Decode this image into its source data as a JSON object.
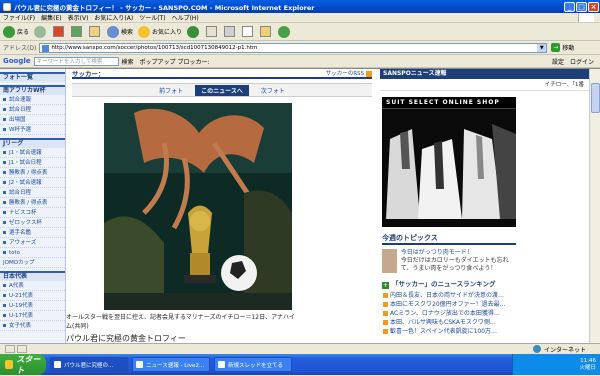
{
  "window": {
    "title": "パウル君に究極の黄金トロフィー！ - サッカー - SANSPO.COM - Microsoft Internet Explorer"
  },
  "menu": [
    "ファイル(F)",
    "編集(E)",
    "表示(V)",
    "お気に入り(A)",
    "ツール(T)",
    "ヘルプ(H)"
  ],
  "toolbar": {
    "back": "戻る",
    "search": "検索",
    "favorites": "お気に入り"
  },
  "address": {
    "label": "アドレス(D)",
    "url": "http://www.sanspo.com/soccer/photos/100713/scd1007130849012-p1.htm",
    "go": "移動"
  },
  "googlebar": {
    "logo": "Google",
    "placeholder": "キーワードを入力して検索",
    "search": "検索",
    "popup": "ポップアップ ブロッカー:",
    "settings": "設定",
    "login": "ログイン"
  },
  "leftnav": {
    "top": "フォト一覧",
    "sec1": {
      "title": "南アフリカW杯",
      "items": [
        "試合速報",
        "試合日程",
        "出場国",
        "W杯予選"
      ]
    },
    "sec2": {
      "title": "Jリーグ",
      "items": [
        "J1・試合速報",
        "J1・試合日程",
        "勝敗表 / 得点表",
        "J2・試合速報",
        "試合日程",
        "勝敗表 / 得点表",
        "ナビスコ杯",
        "ゼロックス杯",
        "選手名鑑",
        "アウォーズ",
        "toto"
      ],
      "extra": "JOMOカップ"
    },
    "sec3": {
      "title": "日本代表",
      "items": [
        "A代表",
        "U-21代表",
        "U-19代表",
        "U-17代表",
        "女子代表"
      ]
    }
  },
  "main": {
    "heading": "サッカー：",
    "rss": "サッカーのRSS",
    "photonav": {
      "prev": "前フォト",
      "current": "このニュースへ",
      "next": "次フォト"
    },
    "caption": "オールスター戦を翌日に控え、記者会見するマリナーズのイチロー＝12日、アナハイム(共同)",
    "next_text": "パウル君に究極の黄金トロフィー"
  },
  "right": {
    "header": "SANSPOニュース速報",
    "subline": "イチロー、「1番",
    "ad_title": "SUIT SELECT ONLINE SHOP",
    "topics_title": "今週のトピックス",
    "topic": {
      "line1": "今日はがっつり肉モード！",
      "line2": "今日だけはカロリーもダイエットも忘れて、うまい肉をがっつり食べよう！"
    },
    "ranking_title": "「サッカー」のニュースランキング",
    "ranking": [
      "内田＆長友、日本の両サイドが決意の渡…",
      "本田にモスクワ20億円オファー！過去最…",
      "ACミラン、ロナウジ放出での本田獲得…",
      "本田、バルサ興味もCSKAモスクワ側…",
      "歓喜一色！スペイン代表凱旋に100万…"
    ]
  },
  "statusbar": {
    "zone": "インターネット"
  },
  "taskbar": {
    "start": "スタート",
    "tasks": [
      "パウル君に究極の…",
      "ニュース速報 - Live2…",
      "新規スレッドを立てる"
    ],
    "time": "11:46",
    "day": "火曜日"
  },
  "colors": {
    "navy": "#1c3f7a",
    "link": "#1f4aa3",
    "accent": "#f39a1e"
  }
}
